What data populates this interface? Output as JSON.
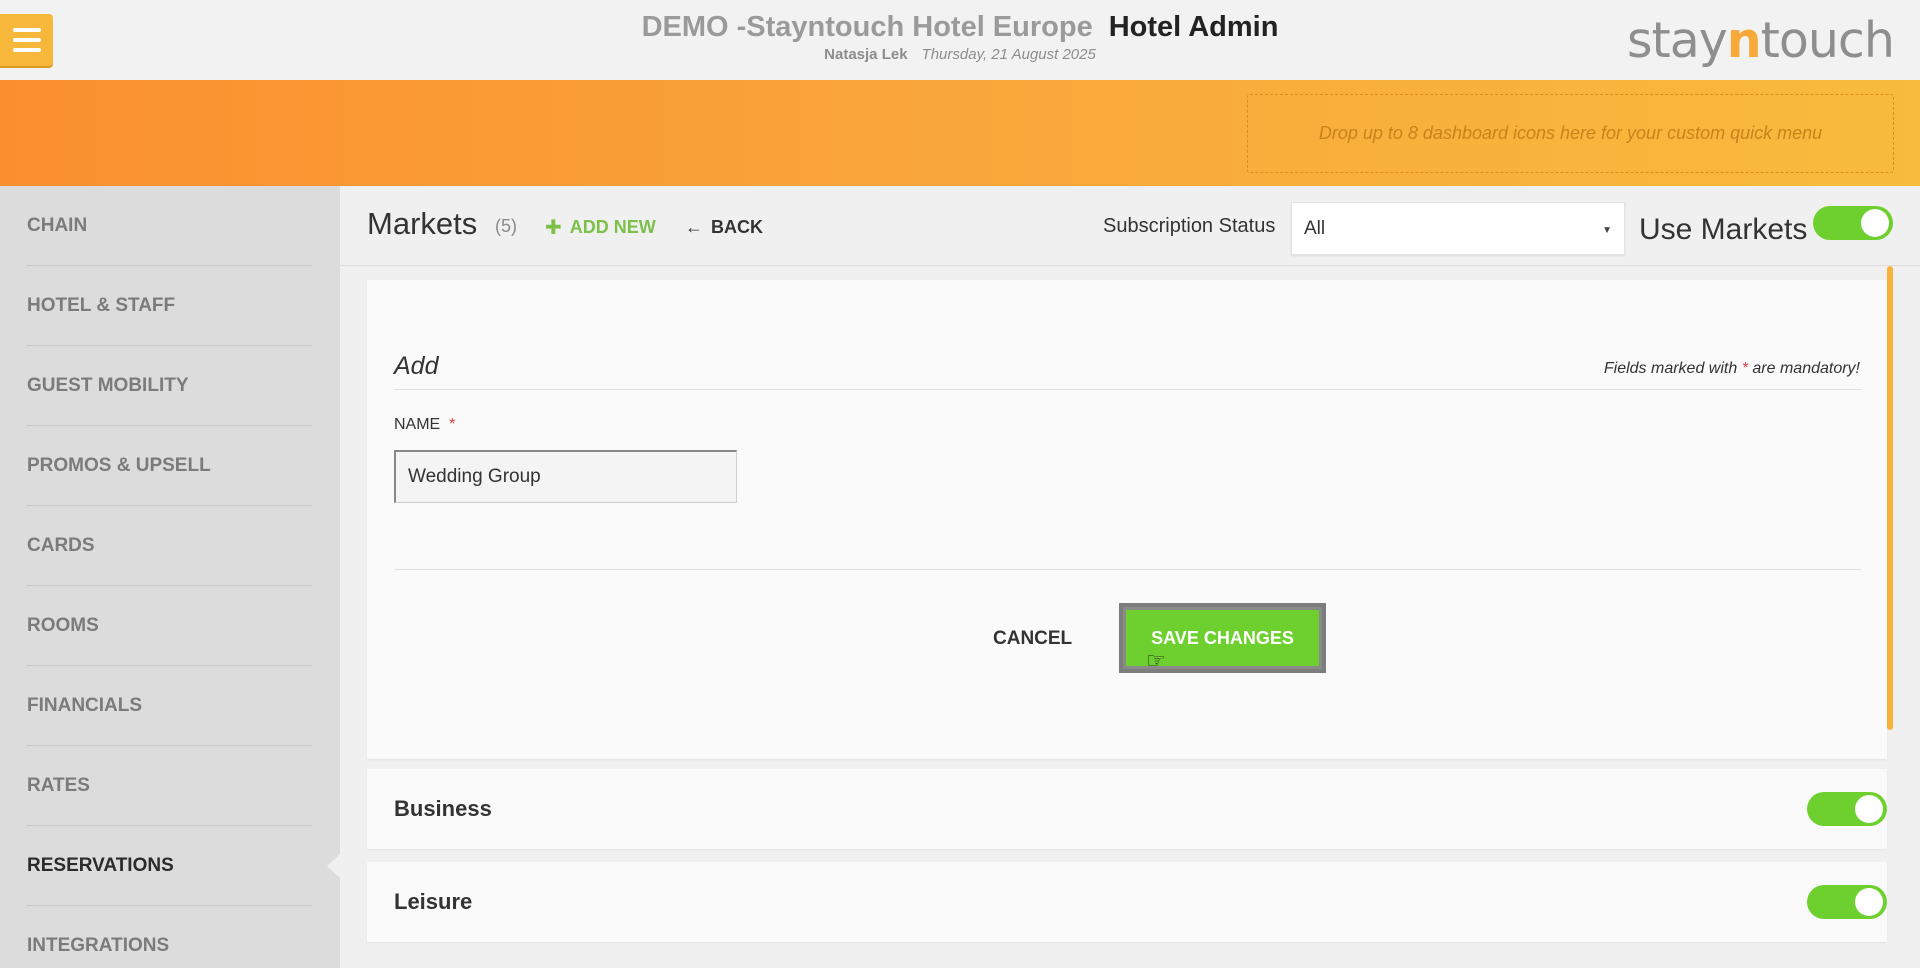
{
  "header": {
    "hotel_name": "DEMO -Stayntouch Hotel Europe",
    "app_name": "Hotel Admin",
    "user": "Natasja Lek",
    "date": "Thursday, 21 August 2025",
    "logo": {
      "part1": "stay",
      "part2": "n",
      "part3": "touch"
    }
  },
  "quick_menu": {
    "dropzone_text": "Drop up to 8 dashboard icons here for your custom quick menu"
  },
  "sidebar": {
    "items": [
      {
        "label": "CHAIN"
      },
      {
        "label": "HOTEL & STAFF"
      },
      {
        "label": "GUEST MOBILITY"
      },
      {
        "label": "PROMOS & UPSELL"
      },
      {
        "label": "CARDS"
      },
      {
        "label": "ROOMS"
      },
      {
        "label": "FINANCIALS"
      },
      {
        "label": "RATES"
      },
      {
        "label": "RESERVATIONS"
      },
      {
        "label": "INTEGRATIONS"
      }
    ],
    "active": "RESERVATIONS"
  },
  "page": {
    "title": "Markets",
    "count": "(5)",
    "add_new_label": "ADD NEW",
    "back_label": "BACK",
    "subscription_status_label": "Subscription Status",
    "subscription_status_value": "All",
    "use_markets_label": "Use Markets",
    "use_markets_enabled": true
  },
  "form": {
    "title": "Add",
    "mandatory_prefix": "Fields marked with",
    "mandatory_star": "*",
    "mandatory_suffix": "are mandatory!",
    "name_label": "NAME",
    "name_star": "*",
    "name_value": "Wedding Group",
    "cancel_label": "CANCEL",
    "save_label": "SAVE CHANGES"
  },
  "markets": [
    {
      "name": "Business",
      "enabled": true
    },
    {
      "name": "Leisure",
      "enabled": true
    }
  ],
  "icons": {
    "menu": "hamburger-menu-icon",
    "add": "plus-icon",
    "back": "arrow-left-icon",
    "caret": "caret-down-icon",
    "cursor": "hand-pointer-icon"
  },
  "colors": {
    "accent_orange": "#f9a93b",
    "toggle_green": "#6dd02e",
    "add_green": "#7cc04a",
    "menu_yellow": "#f7b73a"
  }
}
